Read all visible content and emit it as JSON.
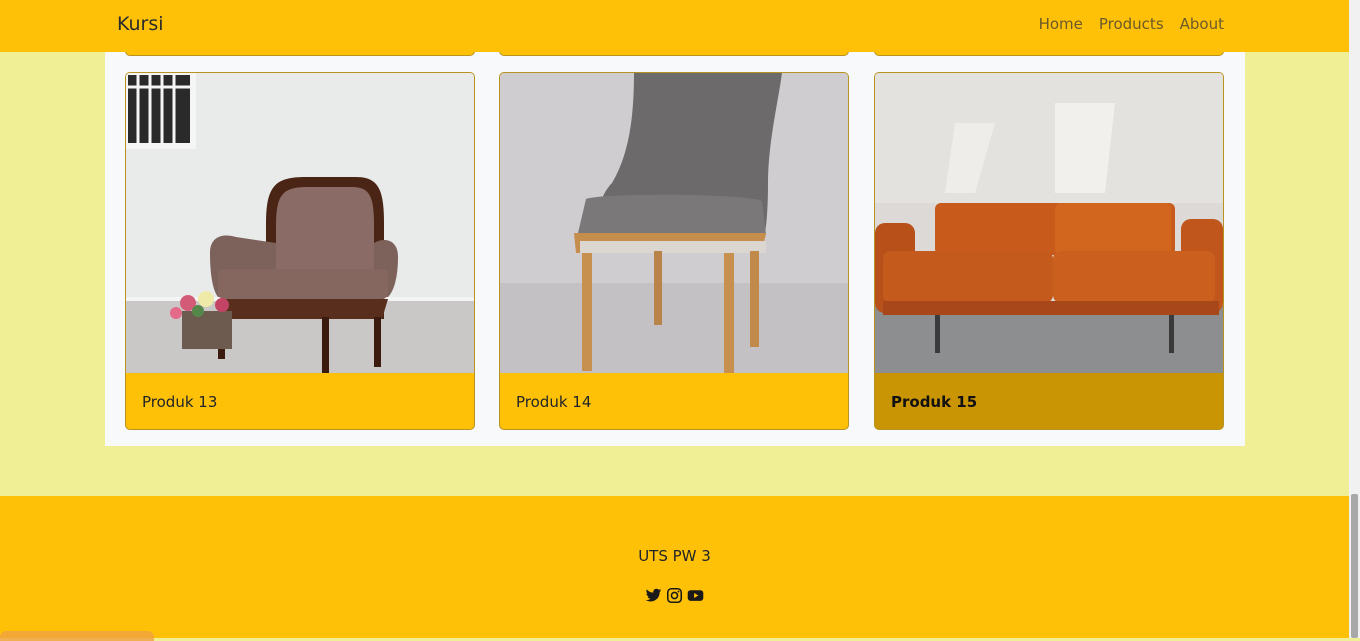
{
  "navbar": {
    "brand": "Kursi",
    "links": [
      "Home",
      "Products",
      "About"
    ]
  },
  "products": [
    {
      "title": "Produk 13",
      "image": "armchair-photo"
    },
    {
      "title": "Produk 14",
      "image": "dining-chair-photo"
    },
    {
      "title": "Produk 15",
      "image": "leather-sofa-photo",
      "hovered": true
    }
  ],
  "footer": {
    "text": "UTS PW 3",
    "socials": [
      "twitter-icon",
      "instagram-icon",
      "youtube-icon"
    ]
  },
  "colors": {
    "accent": "#ffc107",
    "background": "#f1ef95",
    "card_hover": "#c99505"
  }
}
